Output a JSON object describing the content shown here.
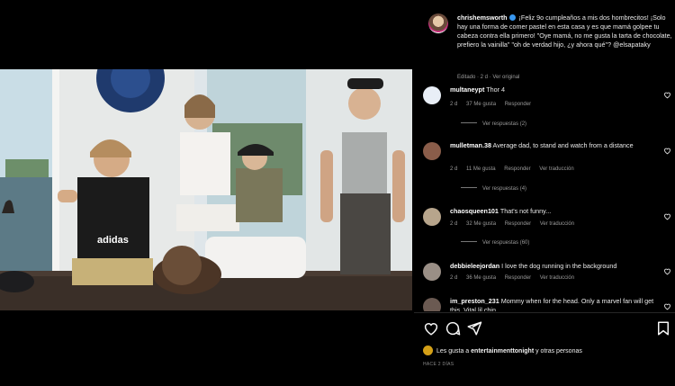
{
  "post": {
    "author": "chrishemsworth",
    "caption": "¡Feliz 9o cumpleaños a mis dos hombrecitos! ¡Solo hay una forma de comer pastel en esta casa y es que mamá golpee tu cabeza contra ella primero! \"Oye mamá, no me gusta la tarta de chocolate, prefiero la vainilla\" \"oh de verdad hijo, ¿y ahora qué\"? @elsapataky",
    "edited": "Editado · 2 d",
    "see_translation": "Ver original",
    "photo_text": "adidas"
  },
  "comments": [
    {
      "user": "multaneypt",
      "text": "Thor 4",
      "time": "2 d",
      "likes": "37 Me gusta",
      "reply": "Responder",
      "translate": "",
      "replies": "Ver respuestas (2)"
    },
    {
      "user": "mulletman.38",
      "text": "Average dad, to stand and watch from a distance",
      "time": "2 d",
      "likes": "11 Me gusta",
      "reply": "Responder",
      "translate": "Ver traducción",
      "replies": "Ver respuestas (4)"
    },
    {
      "user": "chaosqueen101",
      "text": "That's not funny...",
      "time": "2 d",
      "likes": "32 Me gusta",
      "reply": "Responder",
      "translate": "Ver traducción",
      "replies": "Ver respuestas (60)"
    },
    {
      "user": "debbieleejordan",
      "text": "I love the dog running in the background",
      "time": "2 d",
      "likes": "36 Me gusta",
      "reply": "Responder",
      "translate": "Ver traducción",
      "replies": ""
    },
    {
      "user": "im_preston_231",
      "text": "Mommy when for the head. Only a marvel fan will get this. Vital lil chin",
      "time": "",
      "likes": "",
      "reply": "",
      "translate": "",
      "replies": ""
    }
  ],
  "likes_text": "Les gusta a",
  "likes_user": "entertainmenttonight",
  "likes_rest": "y otras personas",
  "date_label": "HACE 2 DÍAS",
  "icons": {
    "like": "heart-icon",
    "comment": "comment-icon",
    "share": "send-icon",
    "save": "bookmark-icon"
  },
  "colors": {
    "verified": "#3897f0",
    "background": "#000000"
  }
}
